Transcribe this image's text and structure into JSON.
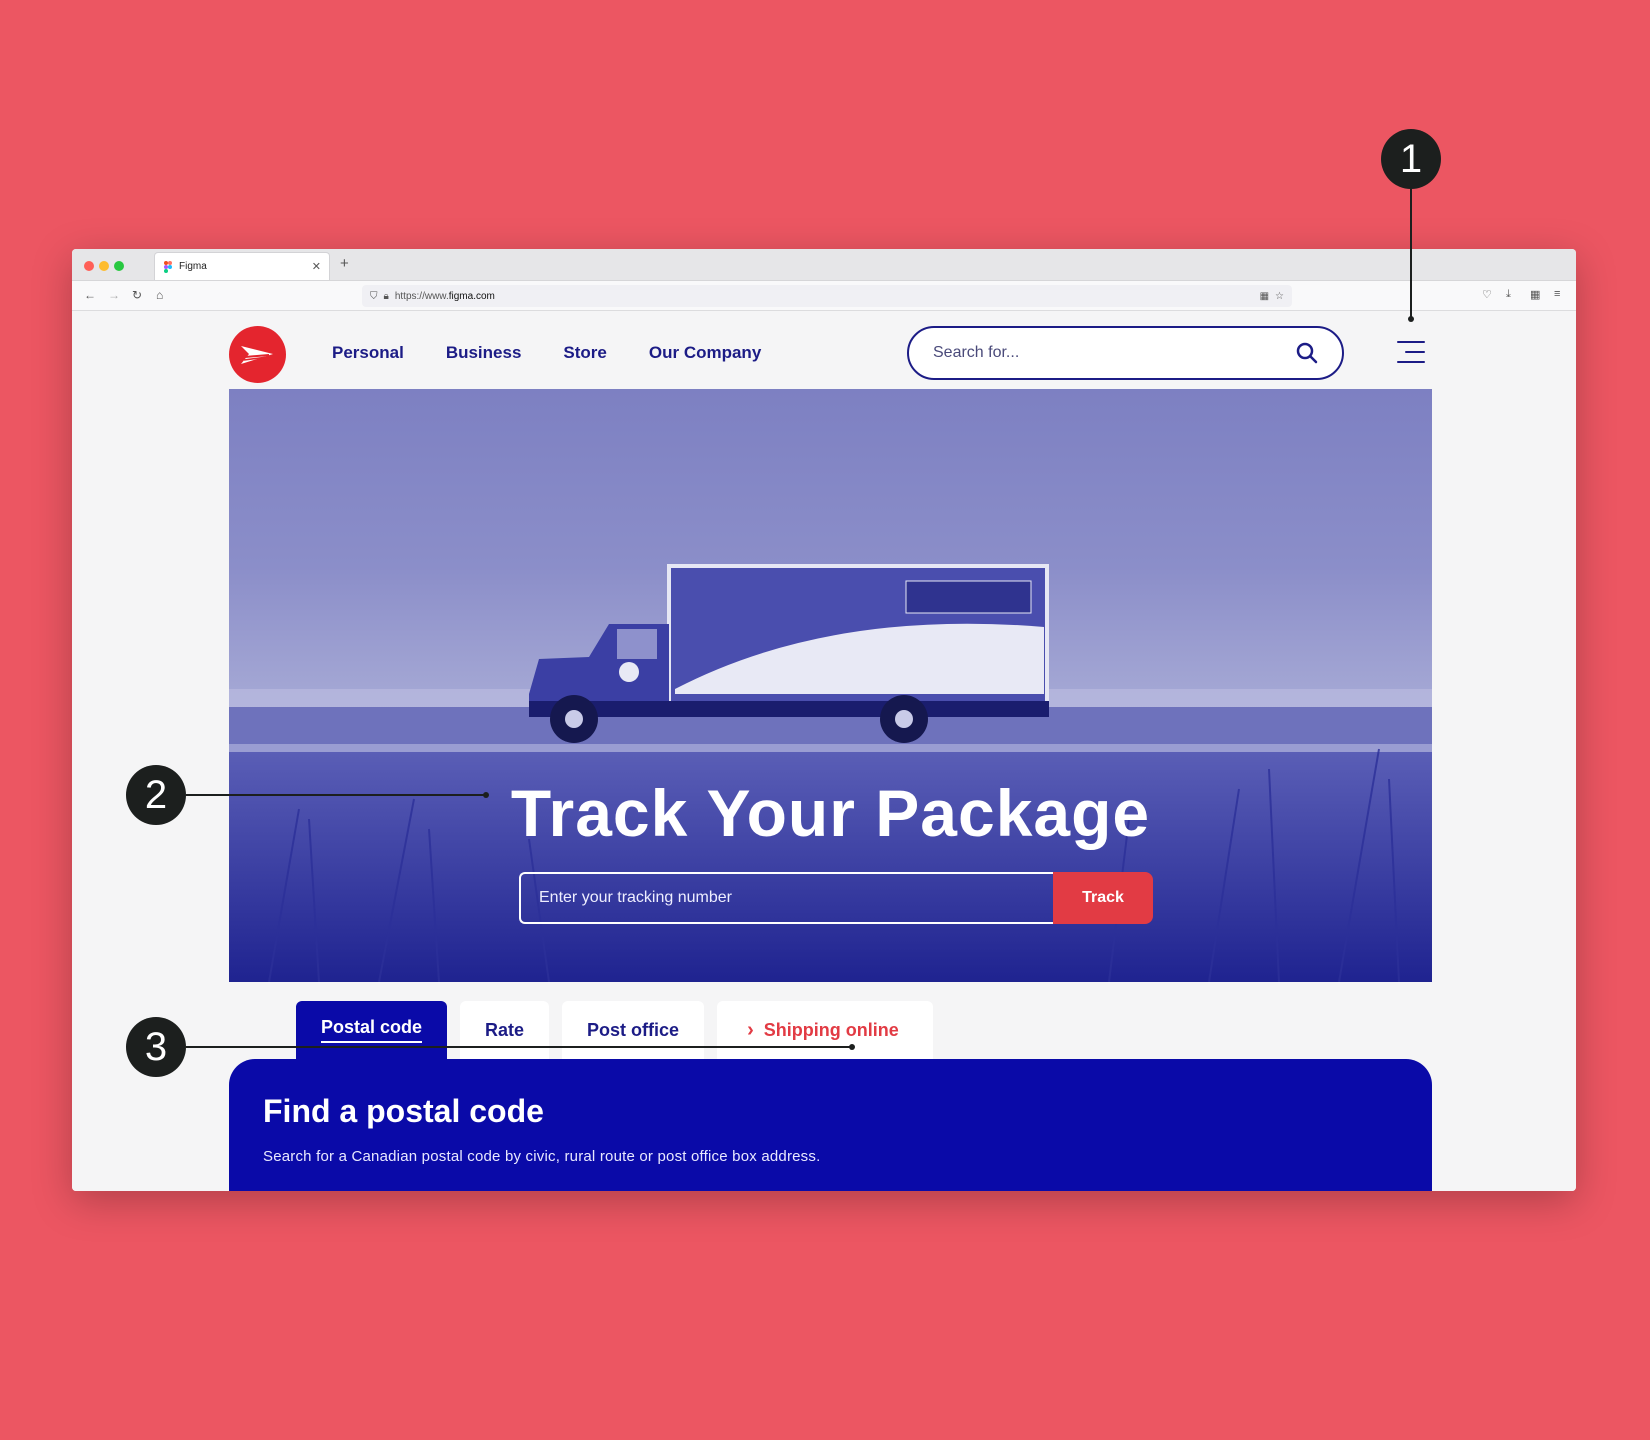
{
  "browser": {
    "tab_title": "Figma",
    "url_prefix": "https://www.",
    "url_domain": "figma.com"
  },
  "nav": {
    "links": [
      "Personal",
      "Business",
      "Store",
      "Our Company"
    ],
    "search_placeholder": "Search for..."
  },
  "hero": {
    "title": "Track Your Package",
    "tracking_placeholder": "Enter your tracking number",
    "track_button": "Track"
  },
  "tabs": [
    {
      "label": "Postal code",
      "active": true
    },
    {
      "label": "Rate",
      "active": false
    },
    {
      "label": "Post office",
      "active": false
    },
    {
      "label": "Shipping online",
      "active": false
    }
  ],
  "panel": {
    "title": "Find a postal code",
    "description": "Search for a Canadian postal code by civic, rural route or post office box address."
  },
  "annotations": [
    "1",
    "2",
    "3"
  ],
  "colors": {
    "background": "#ec5662",
    "brand_blue": "#0a0aa8",
    "nav_blue": "#1c1c86",
    "brand_red": "#e4252e",
    "track_button": "#e23b44"
  }
}
